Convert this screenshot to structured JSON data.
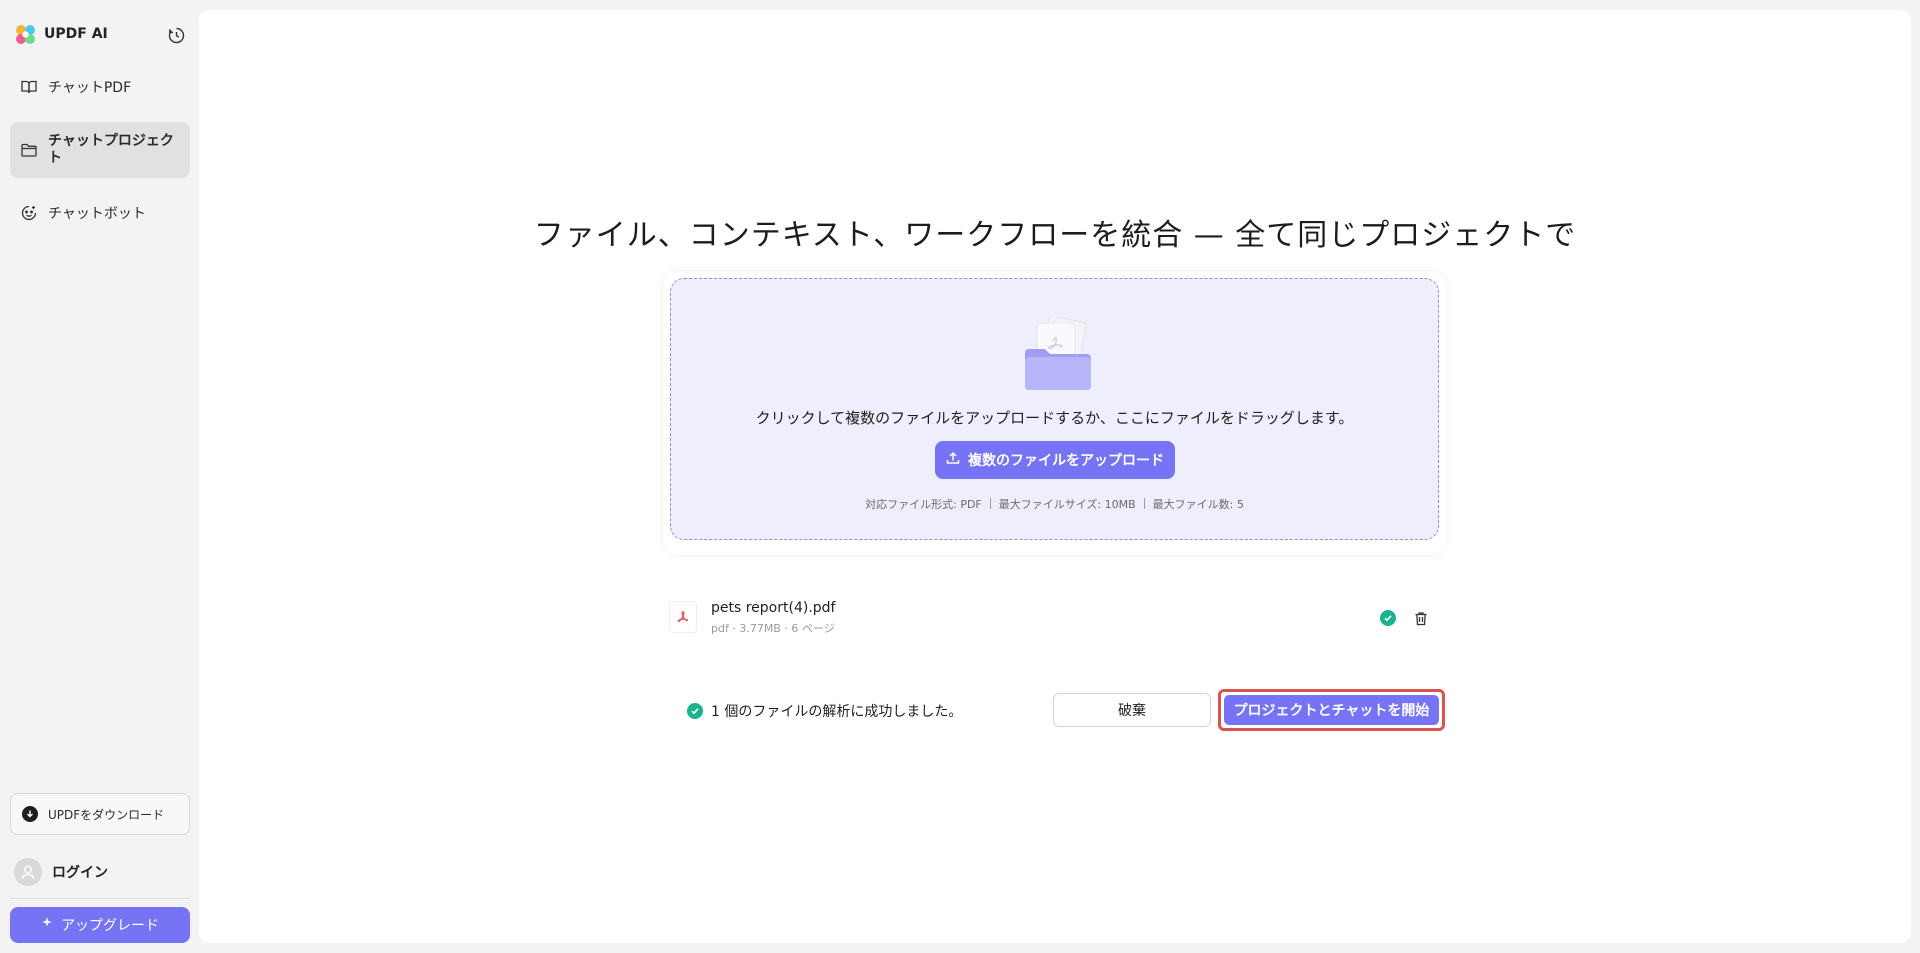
{
  "app": {
    "title": "UPDF AI"
  },
  "sidebar": {
    "items": [
      {
        "label": "チャットPDF",
        "icon": "book-icon"
      },
      {
        "label": "チャットプロジェクト",
        "icon": "folder-icon",
        "active": true
      },
      {
        "label": "チャットボット",
        "icon": "bot-icon"
      }
    ],
    "download_label": "UPDFをダウンロード",
    "login_label": "ログイン",
    "upgrade_label": "アップグレード"
  },
  "main": {
    "headline": "ファイル、コンテキスト、ワークフローを統合 — 全て同じプロジェクトで",
    "dropzone": {
      "instruction": "クリックして複数のファイルをアップロードするか、ここにファイルをドラッグします。",
      "upload_button": "複数のファイルをアップロード",
      "formats": "対応ファイル形式: PDF",
      "max_size": "最大ファイルサイズ: 10MB",
      "max_count": "最大ファイル数: 5"
    },
    "files": [
      {
        "name": "pets report(4).pdf",
        "meta": "pdf · 3.77MB · 6 ページ"
      }
    ],
    "status_text": "1 個のファイルの解析に成功しました。",
    "discard_label": "破棄",
    "start_label": "プロジェクトとチャットを開始"
  },
  "colors": {
    "accent": "#7674f4",
    "success": "#1bb38a",
    "highlight": "#d9544e"
  }
}
